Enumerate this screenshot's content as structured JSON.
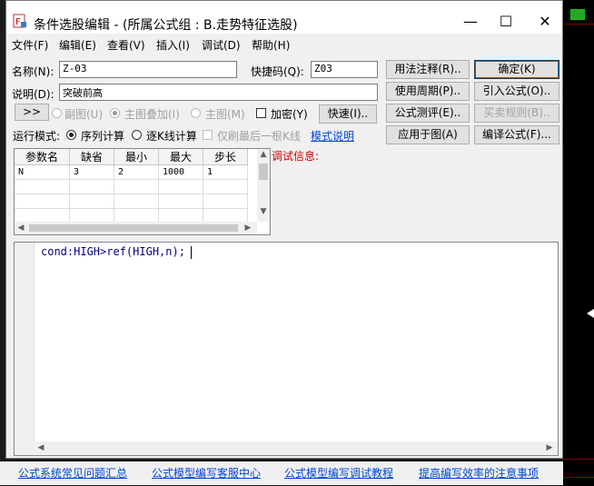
{
  "window": {
    "title": "条件选股编辑 - (所属公式组 : B.走势特征选股)",
    "minimize_glyph": "—",
    "maximize_glyph": "☐",
    "close_glyph": "✕"
  },
  "menu": [
    "文件(F)",
    "编辑(E)",
    "查看(V)",
    "插入(I)",
    "调试(D)",
    "帮助(H)"
  ],
  "form": {
    "name_label": "名称(N):",
    "name_value": "Z-03",
    "shortcut_label": "快捷码(Q):",
    "shortcut_value": "Z03",
    "desc_label": "说明(D):",
    "desc_value": "突破前高",
    "expand_label": ">>",
    "chart_options": {
      "sub_chart": "副图(U)",
      "main_overlay": "主图叠加(I)",
      "main_chart": "主图(M)",
      "encrypt": "加密(Y)"
    },
    "run_mode_label": "运行模式:",
    "seq_calc": "序列计算",
    "kline_calc": "逐K线计算",
    "last_bar_only": "仅刷最后一根K线",
    "mode_help_link": "模式说明",
    "debug_info_label": "调试信息:"
  },
  "buttons": {
    "usage_notes": "用法注释(R)..",
    "ok": "确定(K)",
    "use_period": "使用周期(P)..",
    "import_formula": "引入公式(O)..",
    "quick": "快速(I)..",
    "formula_test": "公式测评(E)..",
    "trade_rules": "买卖规则(B)..",
    "apply_to_chart": "应用于图(A)",
    "compile": "编译公式(F)..."
  },
  "params_table": {
    "columns": [
      "参数名",
      "缺省",
      "最小",
      "最大",
      "步长"
    ],
    "rows": [
      [
        "N",
        "3",
        "2",
        "1000",
        "1"
      ]
    ]
  },
  "editor": {
    "code_line": "cond:HIGH>ref(HIGH,n);"
  },
  "footer_links": [
    "公式系统常见问题汇总",
    "公式模型编写客服中心",
    "公式模型编写调试教程",
    "提高编写效率的注意事项"
  ],
  "colors": {
    "accent_link": "#0046d5",
    "debug_red": "#d10000",
    "code_blue": "#00007f"
  }
}
